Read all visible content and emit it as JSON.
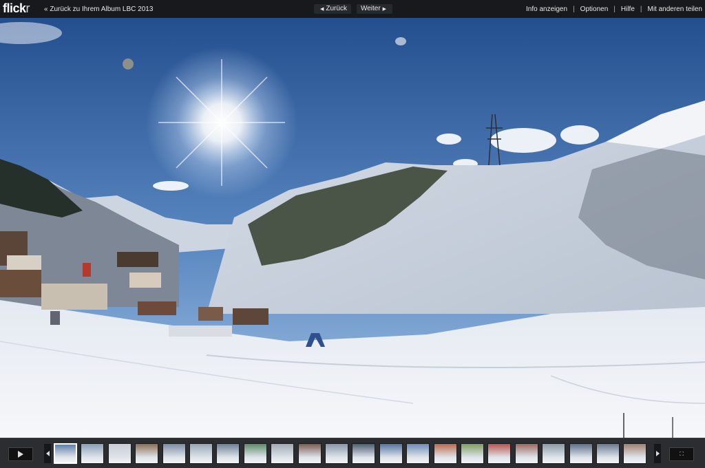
{
  "header": {
    "logo_text": "flick",
    "logo_suffix": "r",
    "back_link": "« Zurück zu Ihrem Album LBC 2013",
    "prev_label": "Zurück",
    "next_label": "Weiter",
    "menu": [
      "Info anzeigen",
      "Optionen",
      "Hilfe",
      "Mit anderen teilen"
    ],
    "separator": "|"
  },
  "filmstrip": {
    "thumbnails": [
      {
        "color": "#5f7fa8",
        "active": true
      },
      {
        "color": "#8a9fb8"
      },
      {
        "color": "#c9ced6"
      },
      {
        "color": "#8b6e55"
      },
      {
        "color": "#7b8aa5"
      },
      {
        "color": "#9aa6b5"
      },
      {
        "color": "#6d7f95"
      },
      {
        "color": "#5c8a6a"
      },
      {
        "color": "#a0a8b2"
      },
      {
        "color": "#7a5c50"
      },
      {
        "color": "#8896a8"
      },
      {
        "color": "#4d5d74"
      },
      {
        "color": "#5473a0"
      },
      {
        "color": "#6d8ab8"
      },
      {
        "color": "#b86a50"
      },
      {
        "color": "#7f9c60"
      },
      {
        "color": "#b8554f"
      },
      {
        "color": "#9a6a60"
      },
      {
        "color": "#8a9aa8"
      },
      {
        "color": "#5d6f8a"
      },
      {
        "color": "#6a7890"
      },
      {
        "color": "#a08070"
      }
    ],
    "fullscreen_glyph": "⛶"
  },
  "colors": {
    "topbar": "#17191c",
    "filmstrip": "#2b2d30",
    "sky_top": "#2c5a98",
    "sky_bottom": "#8fb6e0",
    "snow": "#eef1f6"
  }
}
